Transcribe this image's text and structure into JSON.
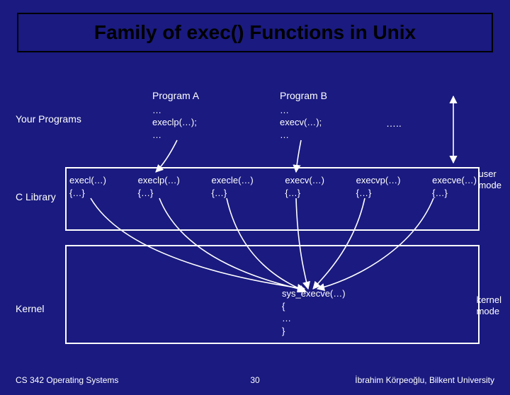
{
  "title": "Family of exec() Functions in Unix",
  "rows": {
    "programs_label": "Your Programs",
    "clibrary_label": "C Library",
    "kernel_label": "Kernel"
  },
  "program_a": {
    "heading": "Program A",
    "body": "…\nexeclp(…);\n…"
  },
  "program_b": {
    "heading": "Program B",
    "body": "…\nexecv(…);\n…"
  },
  "more_dots": "…..",
  "clib": {
    "f0": "execl(…)\n{…}",
    "f1": "execlp(…)\n{…}",
    "f2": "execle(…)\n{…}",
    "f3": "execv(…)\n{…}",
    "f4": "execvp(…)\n{…}",
    "f5": "execve(…)\n{…}"
  },
  "syscall": "sys_execve(…)\n{\n…\n}",
  "mode": {
    "user": "user\nmode",
    "kernel": "kernel\nmode"
  },
  "footer": {
    "left": "CS 342 Operating Systems",
    "center": "30",
    "right": "İbrahim Körpeoğlu, Bilkent University"
  }
}
